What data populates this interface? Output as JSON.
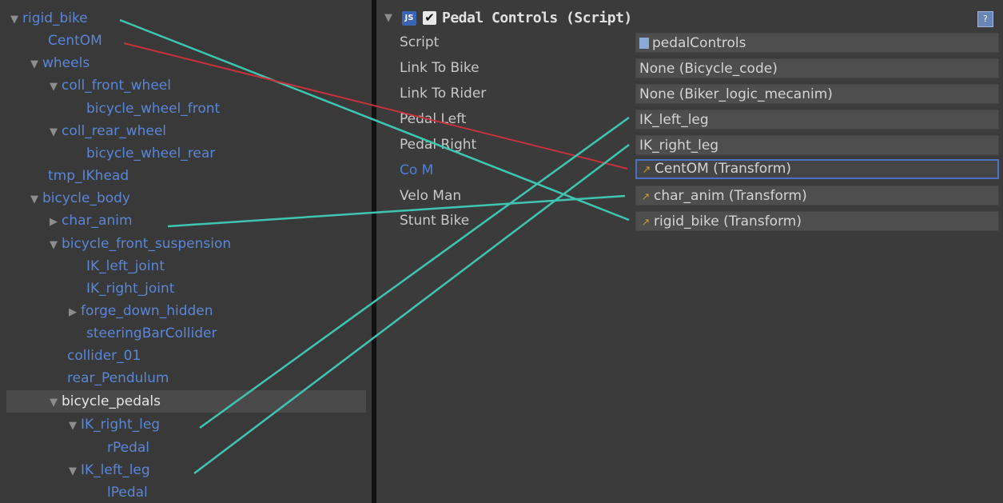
{
  "hierarchy": {
    "items": [
      {
        "label": "rigid_bike",
        "arrow": "▼"
      },
      {
        "label": "CentOM",
        "arrow": ""
      },
      {
        "label": "wheels",
        "arrow": "▼"
      },
      {
        "label": "coll_front_wheel",
        "arrow": "▼"
      },
      {
        "label": "bicycle_wheel_front",
        "arrow": ""
      },
      {
        "label": "coll_rear_wheel",
        "arrow": "▼"
      },
      {
        "label": "bicycle_wheel_rear",
        "arrow": ""
      },
      {
        "label": "tmp_IKhead",
        "arrow": ""
      },
      {
        "label": "bicycle_body",
        "arrow": "▼"
      },
      {
        "label": "char_anim",
        "arrow": "▶"
      },
      {
        "label": "bicycle_front_suspension",
        "arrow": "▼"
      },
      {
        "label": "IK_left_joint",
        "arrow": ""
      },
      {
        "label": "IK_right_joint",
        "arrow": ""
      },
      {
        "label": "forge_down_hidden",
        "arrow": "▶"
      },
      {
        "label": "steeringBarCollider",
        "arrow": ""
      },
      {
        "label": "collider_01",
        "arrow": ""
      },
      {
        "label": "rear_Pendulum",
        "arrow": ""
      },
      {
        "label": "bicycle_pedals",
        "arrow": "▼"
      },
      {
        "label": "IK_right_leg",
        "arrow": "▼"
      },
      {
        "label": "rPedal",
        "arrow": ""
      },
      {
        "label": "IK_left_leg",
        "arrow": "▼"
      },
      {
        "label": "lPedal",
        "arrow": ""
      }
    ]
  },
  "component": {
    "fold_arrow": "▼",
    "js_icon": "JS",
    "checkbox": "✔",
    "title": "Pedal Controls (Script)",
    "help_icon": "?"
  },
  "properties": [
    {
      "label": "Script",
      "value": "pedalControls"
    },
    {
      "label": "Link To Bike",
      "value": "None (Bicycle_code)"
    },
    {
      "label": "Link To Rider",
      "value": "None (Biker_logic_mecanim)"
    },
    {
      "label": "Pedal Left",
      "value": "IK_left_leg"
    },
    {
      "label": "Pedal Right",
      "value": "IK_right_leg"
    },
    {
      "label": "Co M",
      "value": "CentOM (Transform)"
    },
    {
      "label": "Velo Man",
      "value": "char_anim (Transform)"
    },
    {
      "label": "Stunt Bike",
      "value": "rigid_bike (Transform)"
    }
  ],
  "icons": {
    "transform": "↗",
    "script_file": "file-icon"
  },
  "colors": {
    "wire_cyan": "#3fc6b3",
    "wire_red": "#c8323c",
    "link_blue": "#5a86d8"
  }
}
